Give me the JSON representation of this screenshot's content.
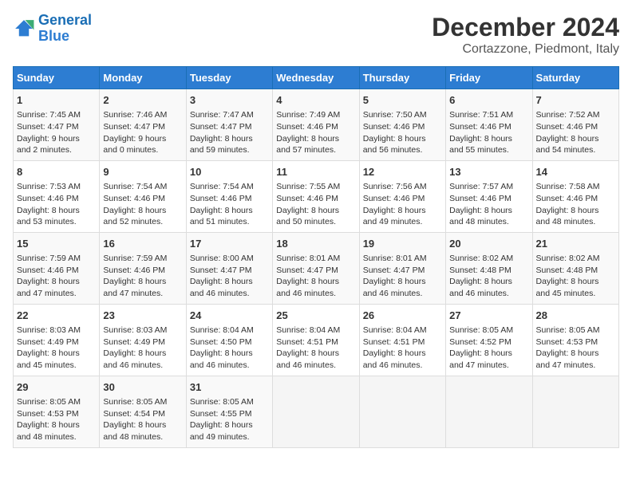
{
  "logo": {
    "line1": "General",
    "line2": "Blue"
  },
  "title": "December 2024",
  "subtitle": "Cortazzone, Piedmont, Italy",
  "headers": [
    "Sunday",
    "Monday",
    "Tuesday",
    "Wednesday",
    "Thursday",
    "Friday",
    "Saturday"
  ],
  "weeks": [
    [
      {
        "day": "1",
        "lines": [
          "Sunrise: 7:45 AM",
          "Sunset: 4:47 PM",
          "Daylight: 9 hours",
          "and 2 minutes."
        ]
      },
      {
        "day": "2",
        "lines": [
          "Sunrise: 7:46 AM",
          "Sunset: 4:47 PM",
          "Daylight: 9 hours",
          "and 0 minutes."
        ]
      },
      {
        "day": "3",
        "lines": [
          "Sunrise: 7:47 AM",
          "Sunset: 4:47 PM",
          "Daylight: 8 hours",
          "and 59 minutes."
        ]
      },
      {
        "day": "4",
        "lines": [
          "Sunrise: 7:49 AM",
          "Sunset: 4:46 PM",
          "Daylight: 8 hours",
          "and 57 minutes."
        ]
      },
      {
        "day": "5",
        "lines": [
          "Sunrise: 7:50 AM",
          "Sunset: 4:46 PM",
          "Daylight: 8 hours",
          "and 56 minutes."
        ]
      },
      {
        "day": "6",
        "lines": [
          "Sunrise: 7:51 AM",
          "Sunset: 4:46 PM",
          "Daylight: 8 hours",
          "and 55 minutes."
        ]
      },
      {
        "day": "7",
        "lines": [
          "Sunrise: 7:52 AM",
          "Sunset: 4:46 PM",
          "Daylight: 8 hours",
          "and 54 minutes."
        ]
      }
    ],
    [
      {
        "day": "8",
        "lines": [
          "Sunrise: 7:53 AM",
          "Sunset: 4:46 PM",
          "Daylight: 8 hours",
          "and 53 minutes."
        ]
      },
      {
        "day": "9",
        "lines": [
          "Sunrise: 7:54 AM",
          "Sunset: 4:46 PM",
          "Daylight: 8 hours",
          "and 52 minutes."
        ]
      },
      {
        "day": "10",
        "lines": [
          "Sunrise: 7:54 AM",
          "Sunset: 4:46 PM",
          "Daylight: 8 hours",
          "and 51 minutes."
        ]
      },
      {
        "day": "11",
        "lines": [
          "Sunrise: 7:55 AM",
          "Sunset: 4:46 PM",
          "Daylight: 8 hours",
          "and 50 minutes."
        ]
      },
      {
        "day": "12",
        "lines": [
          "Sunrise: 7:56 AM",
          "Sunset: 4:46 PM",
          "Daylight: 8 hours",
          "and 49 minutes."
        ]
      },
      {
        "day": "13",
        "lines": [
          "Sunrise: 7:57 AM",
          "Sunset: 4:46 PM",
          "Daylight: 8 hours",
          "and 48 minutes."
        ]
      },
      {
        "day": "14",
        "lines": [
          "Sunrise: 7:58 AM",
          "Sunset: 4:46 PM",
          "Daylight: 8 hours",
          "and 48 minutes."
        ]
      }
    ],
    [
      {
        "day": "15",
        "lines": [
          "Sunrise: 7:59 AM",
          "Sunset: 4:46 PM",
          "Daylight: 8 hours",
          "and 47 minutes."
        ]
      },
      {
        "day": "16",
        "lines": [
          "Sunrise: 7:59 AM",
          "Sunset: 4:46 PM",
          "Daylight: 8 hours",
          "and 47 minutes."
        ]
      },
      {
        "day": "17",
        "lines": [
          "Sunrise: 8:00 AM",
          "Sunset: 4:47 PM",
          "Daylight: 8 hours",
          "and 46 minutes."
        ]
      },
      {
        "day": "18",
        "lines": [
          "Sunrise: 8:01 AM",
          "Sunset: 4:47 PM",
          "Daylight: 8 hours",
          "and 46 minutes."
        ]
      },
      {
        "day": "19",
        "lines": [
          "Sunrise: 8:01 AM",
          "Sunset: 4:47 PM",
          "Daylight: 8 hours",
          "and 46 minutes."
        ]
      },
      {
        "day": "20",
        "lines": [
          "Sunrise: 8:02 AM",
          "Sunset: 4:48 PM",
          "Daylight: 8 hours",
          "and 46 minutes."
        ]
      },
      {
        "day": "21",
        "lines": [
          "Sunrise: 8:02 AM",
          "Sunset: 4:48 PM",
          "Daylight: 8 hours",
          "and 45 minutes."
        ]
      }
    ],
    [
      {
        "day": "22",
        "lines": [
          "Sunrise: 8:03 AM",
          "Sunset: 4:49 PM",
          "Daylight: 8 hours",
          "and 45 minutes."
        ]
      },
      {
        "day": "23",
        "lines": [
          "Sunrise: 8:03 AM",
          "Sunset: 4:49 PM",
          "Daylight: 8 hours",
          "and 46 minutes."
        ]
      },
      {
        "day": "24",
        "lines": [
          "Sunrise: 8:04 AM",
          "Sunset: 4:50 PM",
          "Daylight: 8 hours",
          "and 46 minutes."
        ]
      },
      {
        "day": "25",
        "lines": [
          "Sunrise: 8:04 AM",
          "Sunset: 4:51 PM",
          "Daylight: 8 hours",
          "and 46 minutes."
        ]
      },
      {
        "day": "26",
        "lines": [
          "Sunrise: 8:04 AM",
          "Sunset: 4:51 PM",
          "Daylight: 8 hours",
          "and 46 minutes."
        ]
      },
      {
        "day": "27",
        "lines": [
          "Sunrise: 8:05 AM",
          "Sunset: 4:52 PM",
          "Daylight: 8 hours",
          "and 47 minutes."
        ]
      },
      {
        "day": "28",
        "lines": [
          "Sunrise: 8:05 AM",
          "Sunset: 4:53 PM",
          "Daylight: 8 hours",
          "and 47 minutes."
        ]
      }
    ],
    [
      {
        "day": "29",
        "lines": [
          "Sunrise: 8:05 AM",
          "Sunset: 4:53 PM",
          "Daylight: 8 hours",
          "and 48 minutes."
        ]
      },
      {
        "day": "30",
        "lines": [
          "Sunrise: 8:05 AM",
          "Sunset: 4:54 PM",
          "Daylight: 8 hours",
          "and 48 minutes."
        ]
      },
      {
        "day": "31",
        "lines": [
          "Sunrise: 8:05 AM",
          "Sunset: 4:55 PM",
          "Daylight: 8 hours",
          "and 49 minutes."
        ]
      },
      null,
      null,
      null,
      null
    ]
  ]
}
